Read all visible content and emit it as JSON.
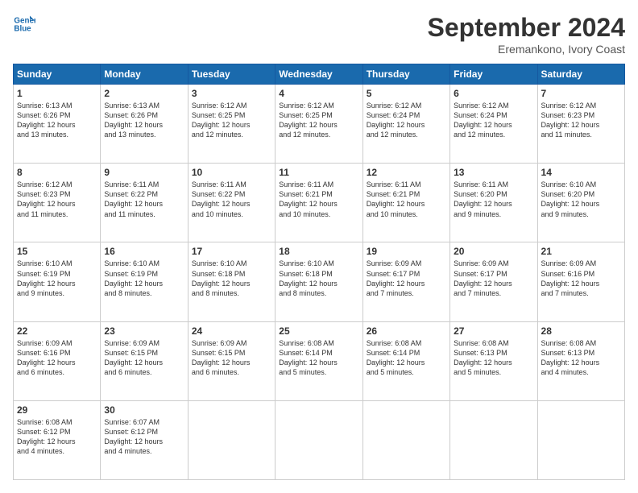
{
  "header": {
    "logo_line1": "General",
    "logo_line2": "Blue",
    "month_title": "September 2024",
    "location": "Eremankono, Ivory Coast"
  },
  "days_of_week": [
    "Sunday",
    "Monday",
    "Tuesday",
    "Wednesday",
    "Thursday",
    "Friday",
    "Saturday"
  ],
  "weeks": [
    [
      {
        "day": "1",
        "text": "Sunrise: 6:13 AM\nSunset: 6:26 PM\nDaylight: 12 hours\nand 13 minutes."
      },
      {
        "day": "2",
        "text": "Sunrise: 6:13 AM\nSunset: 6:26 PM\nDaylight: 12 hours\nand 13 minutes."
      },
      {
        "day": "3",
        "text": "Sunrise: 6:12 AM\nSunset: 6:25 PM\nDaylight: 12 hours\nand 12 minutes."
      },
      {
        "day": "4",
        "text": "Sunrise: 6:12 AM\nSunset: 6:25 PM\nDaylight: 12 hours\nand 12 minutes."
      },
      {
        "day": "5",
        "text": "Sunrise: 6:12 AM\nSunset: 6:24 PM\nDaylight: 12 hours\nand 12 minutes."
      },
      {
        "day": "6",
        "text": "Sunrise: 6:12 AM\nSunset: 6:24 PM\nDaylight: 12 hours\nand 12 minutes."
      },
      {
        "day": "7",
        "text": "Sunrise: 6:12 AM\nSunset: 6:23 PM\nDaylight: 12 hours\nand 11 minutes."
      }
    ],
    [
      {
        "day": "8",
        "text": "Sunrise: 6:12 AM\nSunset: 6:23 PM\nDaylight: 12 hours\nand 11 minutes."
      },
      {
        "day": "9",
        "text": "Sunrise: 6:11 AM\nSunset: 6:22 PM\nDaylight: 12 hours\nand 11 minutes."
      },
      {
        "day": "10",
        "text": "Sunrise: 6:11 AM\nSunset: 6:22 PM\nDaylight: 12 hours\nand 10 minutes."
      },
      {
        "day": "11",
        "text": "Sunrise: 6:11 AM\nSunset: 6:21 PM\nDaylight: 12 hours\nand 10 minutes."
      },
      {
        "day": "12",
        "text": "Sunrise: 6:11 AM\nSunset: 6:21 PM\nDaylight: 12 hours\nand 10 minutes."
      },
      {
        "day": "13",
        "text": "Sunrise: 6:11 AM\nSunset: 6:20 PM\nDaylight: 12 hours\nand 9 minutes."
      },
      {
        "day": "14",
        "text": "Sunrise: 6:10 AM\nSunset: 6:20 PM\nDaylight: 12 hours\nand 9 minutes."
      }
    ],
    [
      {
        "day": "15",
        "text": "Sunrise: 6:10 AM\nSunset: 6:19 PM\nDaylight: 12 hours\nand 9 minutes."
      },
      {
        "day": "16",
        "text": "Sunrise: 6:10 AM\nSunset: 6:19 PM\nDaylight: 12 hours\nand 8 minutes."
      },
      {
        "day": "17",
        "text": "Sunrise: 6:10 AM\nSunset: 6:18 PM\nDaylight: 12 hours\nand 8 minutes."
      },
      {
        "day": "18",
        "text": "Sunrise: 6:10 AM\nSunset: 6:18 PM\nDaylight: 12 hours\nand 8 minutes."
      },
      {
        "day": "19",
        "text": "Sunrise: 6:09 AM\nSunset: 6:17 PM\nDaylight: 12 hours\nand 7 minutes."
      },
      {
        "day": "20",
        "text": "Sunrise: 6:09 AM\nSunset: 6:17 PM\nDaylight: 12 hours\nand 7 minutes."
      },
      {
        "day": "21",
        "text": "Sunrise: 6:09 AM\nSunset: 6:16 PM\nDaylight: 12 hours\nand 7 minutes."
      }
    ],
    [
      {
        "day": "22",
        "text": "Sunrise: 6:09 AM\nSunset: 6:16 PM\nDaylight: 12 hours\nand 6 minutes."
      },
      {
        "day": "23",
        "text": "Sunrise: 6:09 AM\nSunset: 6:15 PM\nDaylight: 12 hours\nand 6 minutes."
      },
      {
        "day": "24",
        "text": "Sunrise: 6:09 AM\nSunset: 6:15 PM\nDaylight: 12 hours\nand 6 minutes."
      },
      {
        "day": "25",
        "text": "Sunrise: 6:08 AM\nSunset: 6:14 PM\nDaylight: 12 hours\nand 5 minutes."
      },
      {
        "day": "26",
        "text": "Sunrise: 6:08 AM\nSunset: 6:14 PM\nDaylight: 12 hours\nand 5 minutes."
      },
      {
        "day": "27",
        "text": "Sunrise: 6:08 AM\nSunset: 6:13 PM\nDaylight: 12 hours\nand 5 minutes."
      },
      {
        "day": "28",
        "text": "Sunrise: 6:08 AM\nSunset: 6:13 PM\nDaylight: 12 hours\nand 4 minutes."
      }
    ],
    [
      {
        "day": "29",
        "text": "Sunrise: 6:08 AM\nSunset: 6:12 PM\nDaylight: 12 hours\nand 4 minutes."
      },
      {
        "day": "30",
        "text": "Sunrise: 6:07 AM\nSunset: 6:12 PM\nDaylight: 12 hours\nand 4 minutes."
      },
      {
        "day": "",
        "text": "",
        "empty": true
      },
      {
        "day": "",
        "text": "",
        "empty": true
      },
      {
        "day": "",
        "text": "",
        "empty": true
      },
      {
        "day": "",
        "text": "",
        "empty": true
      },
      {
        "day": "",
        "text": "",
        "empty": true
      }
    ]
  ]
}
